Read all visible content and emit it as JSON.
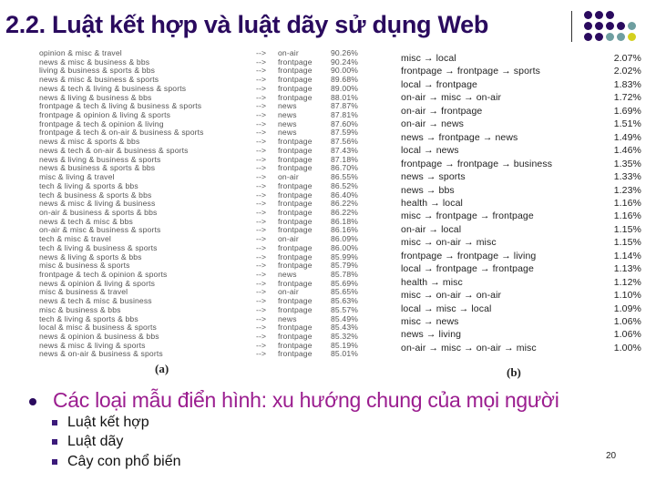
{
  "slide": {
    "title": "2.2. Luật kết hợp và luật dãy sử dụng Web",
    "page_number": "20",
    "decoration_dots": {
      "rows": [
        [
          "purple",
          "purple",
          "purple"
        ],
        [
          "purple",
          "purple",
          "purple",
          "purple",
          "teal"
        ],
        [
          "purple",
          "purple",
          "teal",
          "teal",
          "yellow"
        ]
      ],
      "colors": {
        "purple": "#2a0a5e",
        "teal": "#6e9ea0",
        "yellow": "#d4d01e"
      }
    },
    "colors": {
      "title": "#2a0a5e",
      "main_bullet_text": "#9b1d8f",
      "sub_bullet": "#3b1a7a"
    }
  },
  "figure": {
    "caption_a": "(a)",
    "caption_b": "(b)",
    "table_a": {
      "arrow": "-->",
      "rows": [
        {
          "antecedent": "opinion & misc & travel",
          "consequent": "on-air",
          "support": "90.26%"
        },
        {
          "antecedent": "news & misc & business & bbs",
          "consequent": "frontpage",
          "support": "90.24%"
        },
        {
          "antecedent": "living & business & sports & bbs",
          "consequent": "frontpage",
          "support": "90.00%"
        },
        {
          "antecedent": "news & misc & business & sports",
          "consequent": "frontpage",
          "support": "89.68%"
        },
        {
          "antecedent": "news & tech & living & business & sports",
          "consequent": "frontpage",
          "support": "89.00%"
        },
        {
          "antecedent": "news & living & business & bbs",
          "consequent": "frontpage",
          "support": "88.01%"
        },
        {
          "antecedent": "frontpage & tech & living & business & sports",
          "consequent": "news",
          "support": "87.87%"
        },
        {
          "antecedent": "frontpage & opinion & living & sports",
          "consequent": "news",
          "support": "87.81%"
        },
        {
          "antecedent": "frontpage & tech & opinion & living",
          "consequent": "news",
          "support": "87.60%"
        },
        {
          "antecedent": "frontpage & tech & on-air & business & sports",
          "consequent": "news",
          "support": "87.59%"
        },
        {
          "antecedent": "news & misc & sports & bbs",
          "consequent": "frontpage",
          "support": "87.56%"
        },
        {
          "antecedent": "news & tech & on-air & business & sports",
          "consequent": "frontpage",
          "support": "87.43%"
        },
        {
          "antecedent": "news & living & business & sports",
          "consequent": "frontpage",
          "support": "87.18%"
        },
        {
          "antecedent": "news & business & sports & bbs",
          "consequent": "frontpage",
          "support": "86.70%"
        },
        {
          "antecedent": "misc & living & travel",
          "consequent": "on-air",
          "support": "86.55%"
        },
        {
          "antecedent": "tech & living & sports & bbs",
          "consequent": "frontpage",
          "support": "86.52%"
        },
        {
          "antecedent": "tech & business & sports & bbs",
          "consequent": "frontpage",
          "support": "86.40%"
        },
        {
          "antecedent": "news & misc & living & business",
          "consequent": "frontpage",
          "support": "86.22%"
        },
        {
          "antecedent": "on-air & business & sports & bbs",
          "consequent": "frontpage",
          "support": "86.22%"
        },
        {
          "antecedent": "news & tech & misc & bbs",
          "consequent": "frontpage",
          "support": "86.18%"
        },
        {
          "antecedent": "on-air & misc & business & sports",
          "consequent": "frontpage",
          "support": "86.16%"
        },
        {
          "antecedent": "tech & misc & travel",
          "consequent": "on-air",
          "support": "86.09%"
        },
        {
          "antecedent": "tech & living & business & sports",
          "consequent": "frontpage",
          "support": "86.00%"
        },
        {
          "antecedent": "news & living & sports & bbs",
          "consequent": "frontpage",
          "support": "85.99%"
        },
        {
          "antecedent": "misc & business & sports",
          "consequent": "frontpage",
          "support": "85.79%"
        },
        {
          "antecedent": "frontpage & tech & opinion & sports",
          "consequent": "news",
          "support": "85.78%"
        },
        {
          "antecedent": "news & opinion & living & sports",
          "consequent": "frontpage",
          "support": "85.69%"
        },
        {
          "antecedent": "misc & business & travel",
          "consequent": "on-air",
          "support": "85.65%"
        },
        {
          "antecedent": "news & tech & misc & business",
          "consequent": "frontpage",
          "support": "85.63%"
        },
        {
          "antecedent": "misc & business & bbs",
          "consequent": "frontpage",
          "support": "85.57%"
        },
        {
          "antecedent": "tech & living & sports & bbs",
          "consequent": "news",
          "support": "85.49%"
        },
        {
          "antecedent": "local & misc & business & sports",
          "consequent": "frontpage",
          "support": "85.43%"
        },
        {
          "antecedent": "news & opinion & business & bbs",
          "consequent": "frontpage",
          "support": "85.32%"
        },
        {
          "antecedent": "news & misc & living & sports",
          "consequent": "frontpage",
          "support": "85.19%"
        },
        {
          "antecedent": "news & on-air & business & sports",
          "consequent": "frontpage",
          "support": "85.01%"
        }
      ]
    },
    "table_b": {
      "rows": [
        {
          "sequence": "misc → local",
          "support": "2.07%"
        },
        {
          "sequence": "frontpage → frontpage → sports",
          "support": "2.02%"
        },
        {
          "sequence": "local → frontpage",
          "support": "1.83%"
        },
        {
          "sequence": "on-air → misc → on-air",
          "support": "1.72%"
        },
        {
          "sequence": "on-air → frontpage",
          "support": "1.69%"
        },
        {
          "sequence": "on-air → news",
          "support": "1.51%"
        },
        {
          "sequence": "news → frontpage → news",
          "support": "1.49%"
        },
        {
          "sequence": "local → news",
          "support": "1.46%"
        },
        {
          "sequence": "frontpage → frontpage → business",
          "support": "1.35%"
        },
        {
          "sequence": "news → sports",
          "support": "1.33%"
        },
        {
          "sequence": "news → bbs",
          "support": "1.23%"
        },
        {
          "sequence": "health → local",
          "support": "1.16%"
        },
        {
          "sequence": "misc → frontpage → frontpage",
          "support": "1.16%"
        },
        {
          "sequence": "on-air → local",
          "support": "1.15%"
        },
        {
          "sequence": "misc → on-air → misc",
          "support": "1.15%"
        },
        {
          "sequence": "frontpage → frontpage → living",
          "support": "1.14%"
        },
        {
          "sequence": "local → frontpage → frontpage",
          "support": "1.13%"
        },
        {
          "sequence": "health → misc",
          "support": "1.12%"
        },
        {
          "sequence": "misc → on-air → on-air",
          "support": "1.10%"
        },
        {
          "sequence": "local → misc → local",
          "support": "1.09%"
        },
        {
          "sequence": "misc → news",
          "support": "1.06%"
        },
        {
          "sequence": "news → living",
          "support": "1.06%"
        },
        {
          "sequence": "on-air → misc → on-air → misc",
          "support": "1.00%"
        }
      ]
    }
  },
  "bullets": {
    "main": "Các loại mẫu điển hình: xu hướng chung của mọi người",
    "sub": [
      "Luật kết hợp",
      "Luật dãy",
      "Cây con phổ biến"
    ]
  }
}
